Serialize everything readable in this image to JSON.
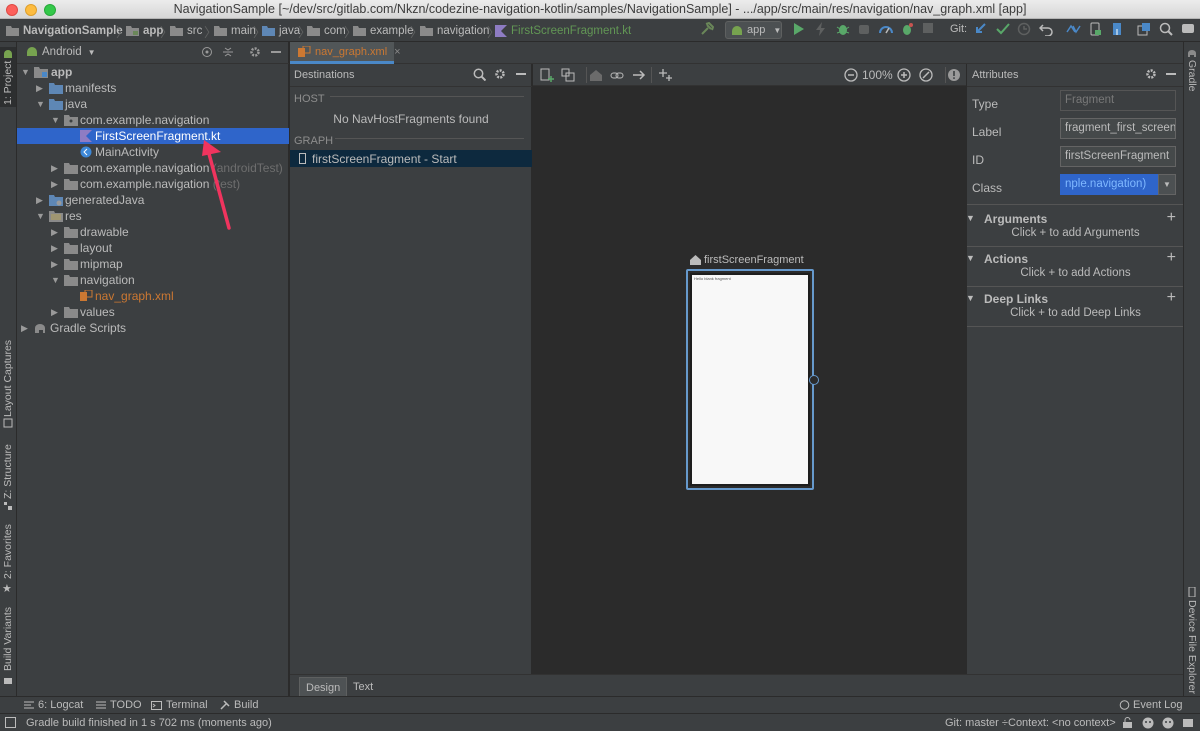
{
  "window": {
    "title": "NavigationSample [~/dev/src/gitlab.com/Nkzn/codezine-navigation-kotlin/samples/NavigationSample] - .../app/src/main/res/navigation/nav_graph.xml [app]"
  },
  "breadcrumbs": [
    "NavigationSample",
    "app",
    "src",
    "main",
    "java",
    "com",
    "example",
    "navigation",
    "FirstScreenFragment.kt"
  ],
  "toolbar": {
    "run_config": "app",
    "git_label": "Git:"
  },
  "left_strip": {
    "project": "1: Project",
    "layout_captures": "Layout Captures",
    "structure": "Z: Structure",
    "favorites": "2: Favorites",
    "build_variants": "Build Variants"
  },
  "right_strip": {
    "gradle": "Gradle",
    "device_file_explorer": "Device File Explorer"
  },
  "project_panel": {
    "view_selector": "Android",
    "tree": [
      {
        "label": "app",
        "suffix": ""
      },
      {
        "label": "manifests",
        "suffix": ""
      },
      {
        "label": "java",
        "suffix": ""
      },
      {
        "label": "com.example.navigation",
        "suffix": ""
      },
      {
        "label": "FirstScreenFragment.kt",
        "suffix": ""
      },
      {
        "label": "MainActivity",
        "suffix": ""
      },
      {
        "label": "com.example.navigation",
        "suffix": " (androidTest)"
      },
      {
        "label": "com.example.navigation",
        "suffix": " (test)"
      },
      {
        "label": "generatedJava",
        "suffix": ""
      },
      {
        "label": "res",
        "suffix": ""
      },
      {
        "label": "drawable",
        "suffix": ""
      },
      {
        "label": "layout",
        "suffix": ""
      },
      {
        "label": "mipmap",
        "suffix": ""
      },
      {
        "label": "navigation",
        "suffix": ""
      },
      {
        "label": "nav_graph.xml",
        "suffix": ""
      },
      {
        "label": "values",
        "suffix": ""
      },
      {
        "label": "Gradle Scripts",
        "suffix": ""
      }
    ]
  },
  "editor": {
    "tab_label": "nav_graph.xml",
    "destinations": {
      "title": "Destinations",
      "host_header": "HOST",
      "host_empty": "No NavHostFragments found",
      "graph_header": "GRAPH",
      "graph_item": "firstScreenFragment - Start"
    },
    "canvas": {
      "zoom": "100%",
      "fragment_label": "firstScreenFragment",
      "fragment_preview_text": "Hello blank fragment"
    },
    "attributes": {
      "title": "Attributes",
      "type_label": "Type",
      "type_placeholder": "Fragment",
      "label_label": "Label",
      "label_value": "fragment_first_screen",
      "id_label": "ID",
      "id_value": "firstScreenFragment",
      "class_label": "Class",
      "class_value": "nple.navigation)",
      "sections": [
        {
          "title": "Arguments",
          "hint": "Click + to add Arguments"
        },
        {
          "title": "Actions",
          "hint": "Click + to add Actions"
        },
        {
          "title": "Deep Links",
          "hint": "Click + to add Deep Links"
        }
      ]
    },
    "bottom_tabs": [
      "Design",
      "Text"
    ]
  },
  "tool_windows": {
    "logcat": "6: Logcat",
    "todo": "TODO",
    "terminal": "Terminal",
    "build": "Build",
    "event_log": "Event Log"
  },
  "status_bar": {
    "message": "Gradle build finished in 1 s 702 ms (moments ago)",
    "git_branch": "Git: master ÷",
    "context": "Context: <no context>"
  },
  "colors": {
    "selection": "#2f65ca",
    "annotation_arrow": "#f0345e",
    "kotlin_file": "#ffffff",
    "xml_file": "#cc7832"
  }
}
